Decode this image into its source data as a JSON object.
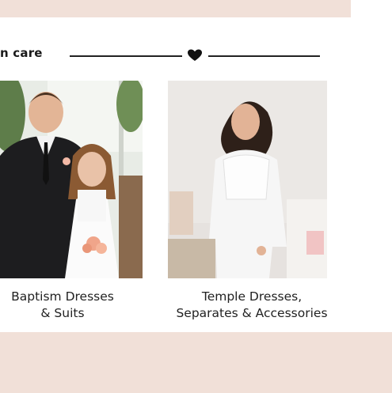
{
  "section": {
    "heading_fragment": "n care"
  },
  "cards": [
    {
      "line1": "Baptism Dresses",
      "line2": "& Suits",
      "image": "boy-girl-baptism-photo"
    },
    {
      "line1": "Temple Dresses,",
      "line2": "Separates & Accessories",
      "image": "woman-white-dress-photo"
    }
  ],
  "colors": {
    "band": "#f1e0d8",
    "rule": "#222222"
  }
}
